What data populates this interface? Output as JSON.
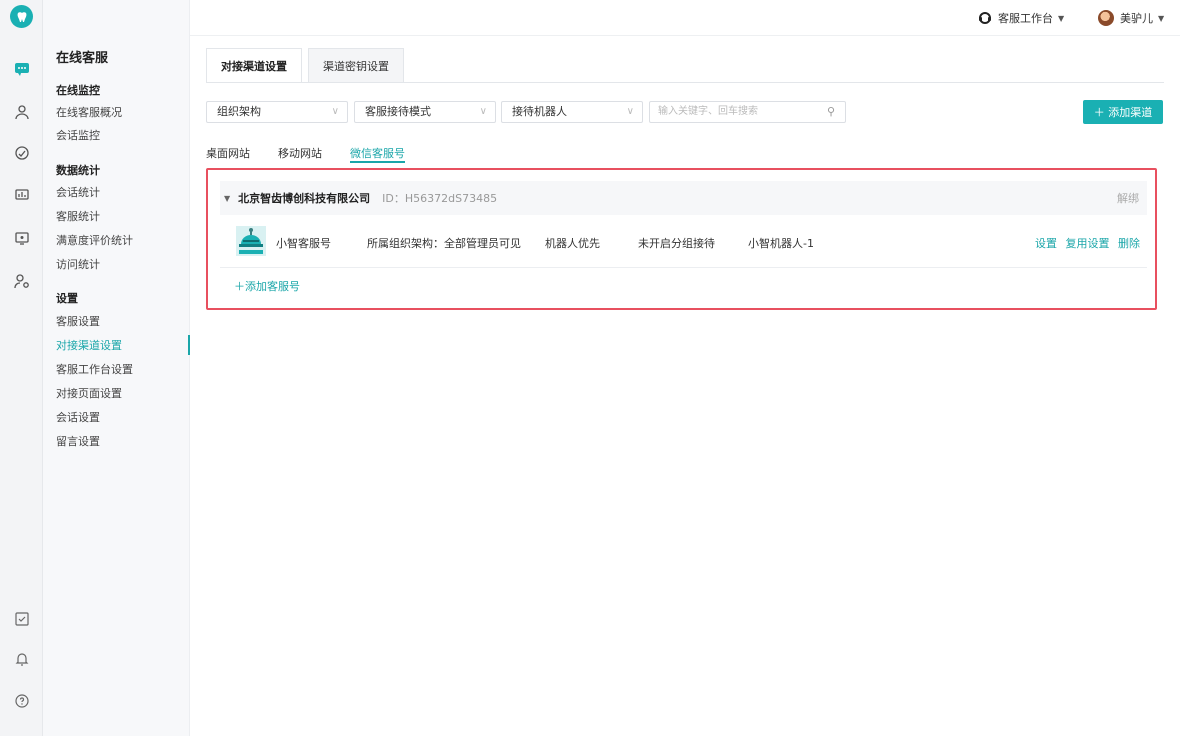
{
  "rail": {
    "logo_icon": "tooth-logo-icon",
    "icons": [
      "chat-icon",
      "users-icon",
      "dashboard-icon",
      "stats-icon",
      "monitor-icon",
      "user-settings-icon"
    ],
    "bottom_icons": [
      "checkbox-icon",
      "bell-icon",
      "help-icon"
    ]
  },
  "subnav": {
    "title": "在线客服",
    "groups": [
      {
        "label": "在线监控",
        "items": [
          "在线客服概况",
          "会话监控"
        ]
      },
      {
        "label": "数据统计",
        "items": [
          "会话统计",
          "客服统计",
          "满意度评价统计",
          "访问统计"
        ]
      },
      {
        "label": "设置",
        "items": [
          "客服设置",
          "对接渠道设置",
          "客服工作台设置",
          "对接页面设置",
          "会话设置",
          "留言设置"
        ]
      }
    ],
    "active_item": "对接渠道设置"
  },
  "header": {
    "workspace_label": "客服工作台",
    "user_name": "美驴儿"
  },
  "tabs": [
    "对接渠道设置",
    "渠道密钥设置"
  ],
  "filters": {
    "org": "组织架构",
    "mode": "客服接待模式",
    "robot": "接待机器人",
    "search_placeholder": "输入关键字、回车搜索",
    "add_button": "＋ 添加渠道"
  },
  "subtabs": [
    "桌面网站",
    "移动网站",
    "微信客服号"
  ],
  "card": {
    "org_name": "北京智齿博创科技有限公司",
    "org_id": "ID：H56372dS73485",
    "unbind": "解绑",
    "account": {
      "name": "小智客服号",
      "org_scope": "所属组织架构：全部管理员可见",
      "priority": "机器人优先",
      "group_mode": "未开启分组接待",
      "robot": "小智机器人-1",
      "ops": [
        "设置",
        "复用设置",
        "删除"
      ]
    },
    "add_account": "＋添加客服号"
  },
  "colors": {
    "accent": "#1ab0b3",
    "highlight": "#e8505f"
  }
}
